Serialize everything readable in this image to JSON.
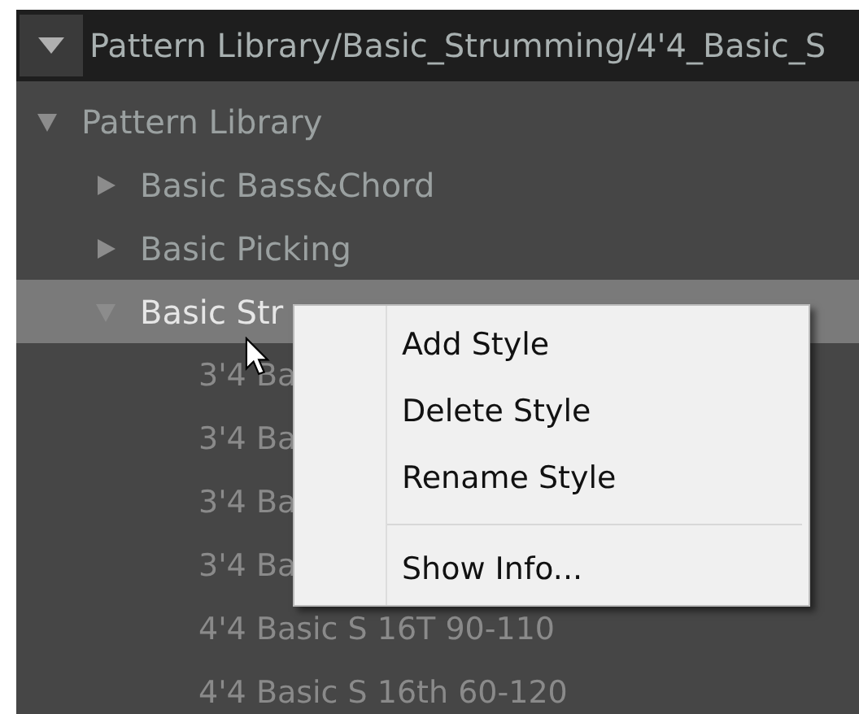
{
  "path_bar": {
    "path": "Pattern Library/Basic_Strumming/4'4_Basic_S",
    "expanded": true
  },
  "tree": [
    {
      "label": "Pattern Library",
      "expanded": true,
      "selected": false,
      "children": [
        {
          "label": "Basic Bass&Chord",
          "expanded": false,
          "selected": false
        },
        {
          "label": "Basic Picking",
          "expanded": false,
          "selected": false
        },
        {
          "label": "Basic Str",
          "expanded": true,
          "selected": true,
          "children": [
            {
              "label": "3'4 Ba",
              "selected": false
            },
            {
              "label": "3'4 Ba",
              "selected": false
            },
            {
              "label": "3'4 Ba",
              "selected": false
            },
            {
              "label": "3'4 Ba",
              "selected": false
            },
            {
              "label": "4'4 Basic S 16T 90-110",
              "selected": false
            },
            {
              "label": "4'4 Basic S 16th 60-120",
              "selected": false
            }
          ]
        }
      ]
    }
  ],
  "context_menu": {
    "items": [
      {
        "kind": "item",
        "label": "Add Style"
      },
      {
        "kind": "item",
        "label": "Delete Style"
      },
      {
        "kind": "item",
        "label": "Rename Style"
      },
      {
        "kind": "separator"
      },
      {
        "kind": "item",
        "label": "Show Info..."
      }
    ]
  }
}
